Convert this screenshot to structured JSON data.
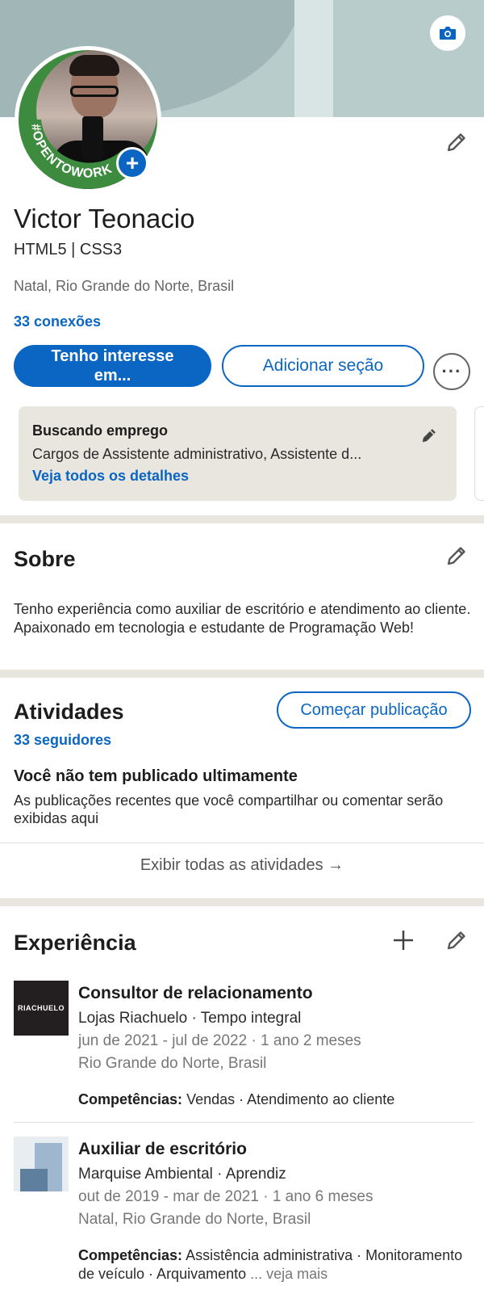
{
  "profile": {
    "open_to_work_badge": "#OPENTOWORK",
    "name": "Victor Teonacio",
    "headline": "HTML5 | CSS3",
    "location": "Natal, Rio Grande do Norte, Brasil",
    "connections": "33 conexões"
  },
  "actions": {
    "primary_line1": "Tenho interesse",
    "primary_line2": "em...",
    "add_section": "Adicionar seção",
    "more": "···"
  },
  "open_to_work": {
    "title": "Buscando emprego",
    "roles": "Cargos de Assistente administrativo, Assistente d...",
    "details_link": "Veja todos os detalhes"
  },
  "about": {
    "title": "Sobre",
    "text": "Tenho experiência como auxiliar de escritório e atendimento ao cliente. Apaixonado em tecnologia e estudante de Programação Web!"
  },
  "activity": {
    "title": "Atividades",
    "start_post": "Começar publicação",
    "followers": "33 seguidores",
    "empty_title": "Você não tem publicado ultimamente",
    "empty_text": "As publicações recentes que você compartilhar ou comentar serão exibidas aqui",
    "show_all": "Exibir todas as atividades →"
  },
  "experience": {
    "title": "Experiência",
    "items": [
      {
        "logo_text": "RIACHUELO",
        "title": "Consultor de relacionamento",
        "company": "Lojas Riachuelo · Tempo integral",
        "dates": "jun de 2021 - jul de 2022 · 1 ano 2 meses",
        "location": "Rio Grande do Norte, Brasil",
        "skills_label": "Competências:",
        "skills": "Vendas · Atendimento ao cliente"
      },
      {
        "title": "Auxiliar de escritório",
        "company": "Marquise Ambiental · Aprendiz",
        "dates": "out de 2019 - mar de 2021 · 1 ano 6 meses",
        "location": "Natal, Rio Grande do Norte, Brasil",
        "skills_label": "Competências:",
        "skills": "Assistência administrativa · Monitoramento de veículo · Arquivamento",
        "see_more": "... veja mais"
      }
    ]
  },
  "colors": {
    "accent": "#0a66c2",
    "open_to_work_green": "#3d8b3e",
    "card_bg": "#e9e5df"
  }
}
